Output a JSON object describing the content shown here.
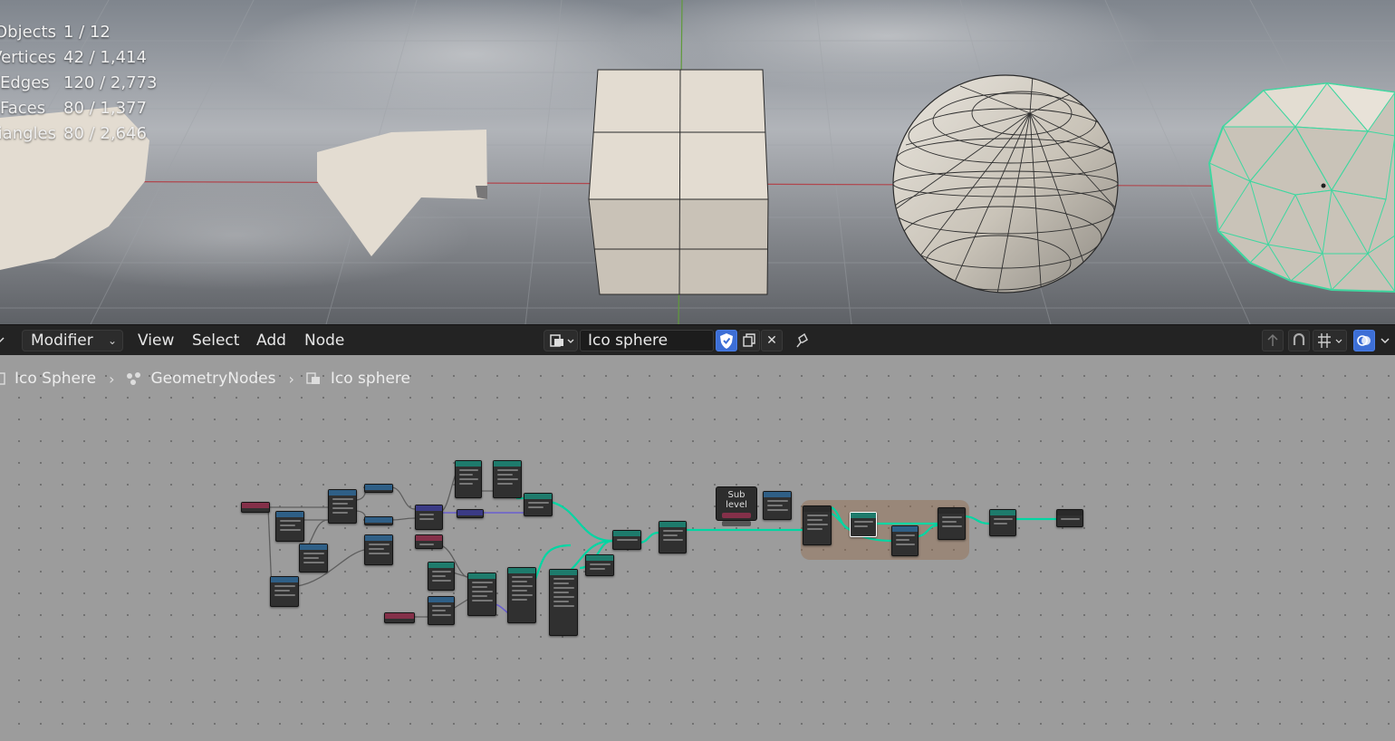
{
  "viewport": {
    "stats": [
      {
        "label": "Objects",
        "value": "1 / 12"
      },
      {
        "label": "Vertices",
        "value": "42 / 1,414"
      },
      {
        "label": "Edges",
        "value": "120 / 2,773"
      },
      {
        "label": "Faces",
        "value": "80 / 1,377"
      },
      {
        "label": "Triangles",
        "value": "80 / 2,646"
      }
    ]
  },
  "header": {
    "mode": "Modifier",
    "menus": [
      "View",
      "Select",
      "Add",
      "Node"
    ],
    "node_tree_name": "Ico sphere"
  },
  "breadcrumb": {
    "object": "Ico Sphere",
    "modifier": "GeometryNodes",
    "node_tree": "Ico sphere"
  },
  "node_editor": {
    "sublevel_label": "Sub level"
  },
  "colors": {
    "geometry_header": "#1e7b6c",
    "math_header": "#2f5f86",
    "input_header": "#843049",
    "vector_header": "#3b3b85",
    "geometry_link": "#00d6a3",
    "selection_outline": "#3fd7a0",
    "accent_blue": "#3d6fd6"
  }
}
